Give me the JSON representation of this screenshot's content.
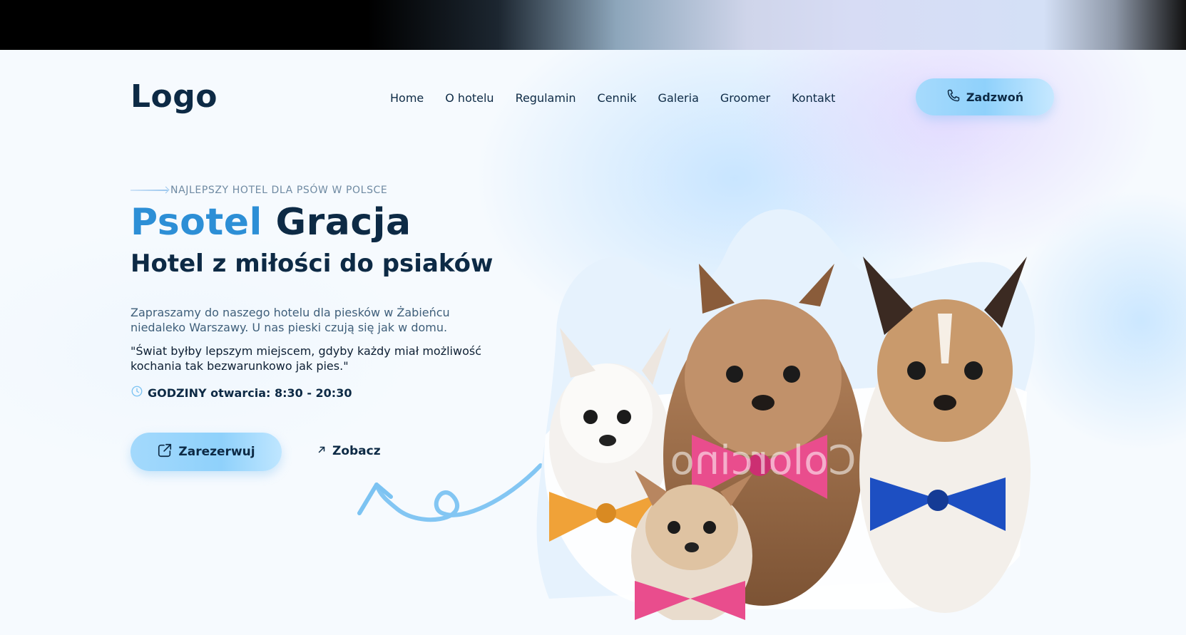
{
  "header": {
    "logo": "Logo",
    "nav": [
      "Home",
      "O hotelu",
      "Regulamin",
      "Cennik",
      "Galeria",
      "Groomer",
      "Kontakt"
    ],
    "call_button": "Zadzwoń",
    "call_icon": "phone-icon"
  },
  "hero": {
    "eyebrow": "NAJLEPSZY HOTEL DLA PSÓW W POLSCE",
    "title_accent": "Psotel",
    "title_main": "Gracja",
    "subtitle": "Hotel z miłości do psiaków",
    "description": "Zapraszamy do naszego hotelu dla piesków w Żabieńcu niedaleko Warszawy. U nas pieski czują się jak w domu.",
    "quote": "\"Świat byłby lepszym miejscem, gdyby każdy miał możliwość kochania tak bezwarunkowo jak pies.\"",
    "hours": "GODZINY otwarcia: 8:30 - 20:30",
    "book_button": "Zarezerwuj",
    "see_link": "Zobacz",
    "watermark": "Colorcino"
  },
  "colors": {
    "accent": "#2d8fd6",
    "dark": "#0d2a45",
    "button_bg": "#8fd1fb"
  }
}
